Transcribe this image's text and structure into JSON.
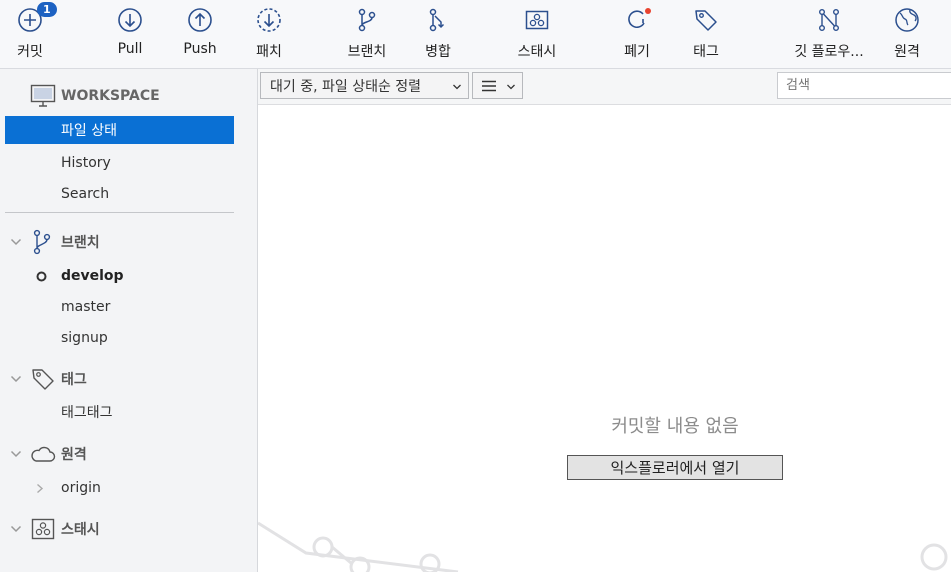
{
  "toolbar": {
    "commit_label": "커밋",
    "commit_badge": "1",
    "pull_label": "Pull",
    "push_label": "Push",
    "patch_label": "패치",
    "branch_label": "브랜치",
    "merge_label": "병합",
    "stash_label": "스태시",
    "discard_label": "폐기",
    "tag_label": "태그",
    "gitflow_label": "깃 플로우...",
    "remote_label": "원격"
  },
  "sidebar": {
    "workspace_header": "WORKSPACE",
    "workspace_items": [
      "파일 상태",
      "History",
      "Search"
    ],
    "branches_header": "브랜치",
    "branches": [
      "develop",
      "master",
      "signup"
    ],
    "current_branch": "develop",
    "tags_header": "태그",
    "tags": [
      "태그태그"
    ],
    "remotes_header": "원격",
    "remotes": [
      "origin"
    ],
    "stash_header": "스태시"
  },
  "filterbar": {
    "sort_filter": "대기 중, 파일 상태순 정렬",
    "search_placeholder": "검색"
  },
  "main": {
    "empty_message": "커밋할 내용 없음",
    "open_explorer_button": "익스플로러에서 열기"
  },
  "colors": {
    "accent": "#0a70d4",
    "badge": "#1d62c2",
    "icon": "#2b4f8e",
    "notification_dot": "#e8432e"
  }
}
